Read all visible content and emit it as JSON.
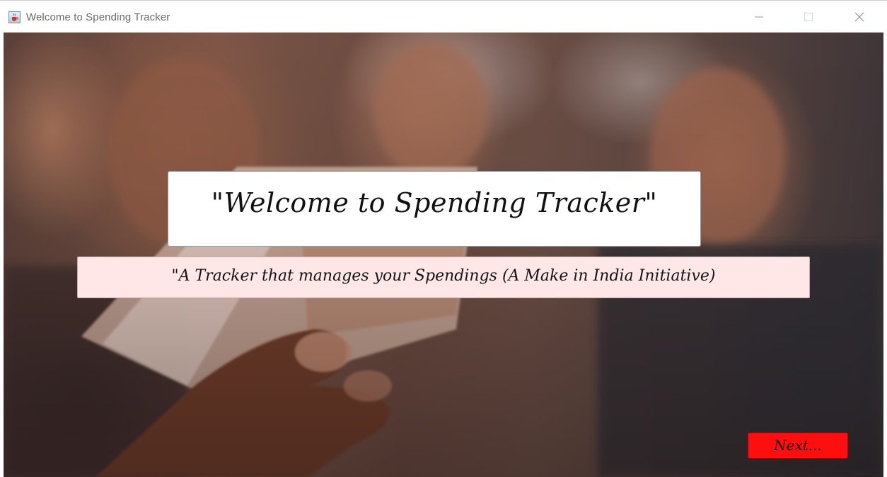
{
  "window": {
    "title": "Welcome to Spending Tracker",
    "app_icon": "java-cup-icon",
    "controls": {
      "minimize_icon": "minimize-icon",
      "maximize_icon": "maximize-icon",
      "close_icon": "close-icon"
    }
  },
  "banner": {
    "heading": "\"Welcome to Spending Tracker\"",
    "tagline": "\"A Tracker that manages your Spendings (A Make in India Initiative)"
  },
  "actions": {
    "next_label": "Next..."
  },
  "colors": {
    "next_button": "#fe0f0f",
    "tagline_background": "#ffe7e7",
    "heading_background": "#ffffff"
  }
}
